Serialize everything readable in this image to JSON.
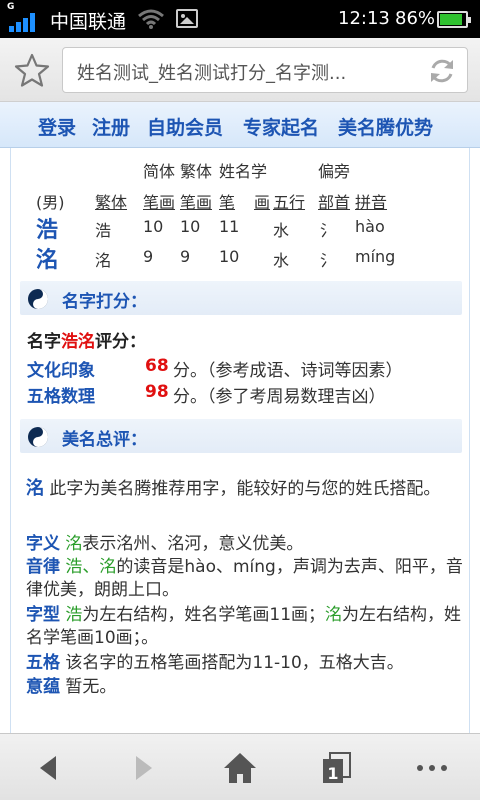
{
  "status_bar": {
    "g_badge": "G",
    "carrier": "中国联通",
    "time": "12:13",
    "battery_pct": "86%",
    "battery_level": 0.86,
    "signal_icon": "signal-bars-icon",
    "wifi_icon": "wifi-icon",
    "picture_icon": "picture-icon"
  },
  "url_bar": {
    "url_text": "姓名测试_姓名测试打分_名字测...",
    "bookmark_icon": "star-icon",
    "reload_icon": "reload-icon"
  },
  "nav": {
    "items": [
      "登录",
      "注册",
      "自助会员",
      "专家起名",
      "美名腾优势"
    ]
  },
  "name_table": {
    "header_row1": [
      "简体",
      "繁体",
      "姓名学",
      "偏旁"
    ],
    "header_row2": [
      "(男)",
      "繁体",
      "笔画",
      "笔画",
      "笔",
      "画",
      "五行",
      "部首",
      "拼音"
    ],
    "rows": [
      {
        "char": "浩",
        "trad": "浩",
        "s1": "10",
        "s2": "10",
        "s3": "11",
        "wuxing": "水",
        "radical": "氵",
        "pinyin": "hào"
      },
      {
        "char": "洺",
        "trad": "洺",
        "s1": "9",
        "s2": "9",
        "s3": "10",
        "wuxing": "水",
        "radical": "氵",
        "pinyin": "míng"
      }
    ]
  },
  "score_section": {
    "title": "名字打分：",
    "label_pre": "名字",
    "label_name": "浩洺",
    "label_post": "评分：",
    "items": [
      {
        "label": "文化印象",
        "score": "68",
        "text": "分。（参考成语、诗词等因素）"
      },
      {
        "label": "五格数理",
        "score": "98",
        "text": "分。（参了考周易数理吉凶）"
      }
    ]
  },
  "review_section": {
    "title": "美名总评：",
    "intro_char": "洺",
    "intro_text": "此字为美名腾推荐用字，能较好的与您的姓氏搭配。",
    "meaning_label": "字义",
    "meaning_char": "洺",
    "meaning_text": "表示洺州、洺河，意义优美。",
    "rhythm_label": "音律",
    "rhythm_char1": "浩",
    "rhythm_sep": "、",
    "rhythm_char2": "洺",
    "rhythm_text": "的读音是hào、míng，声调为去声、阳平，音律优美，朗朗上口。",
    "shape_label": "字型",
    "shape_char1": "浩",
    "shape_text1": "为左右结构，姓名学笔画11画；",
    "shape_char2": "洺",
    "shape_text2": "为左右结构，姓名学笔画10画；。",
    "wuge_label": "五格",
    "wuge_text": "该名字的五格笔画搭配为11-10，五格大吉。",
    "yiyun_label": "意蕴",
    "yiyun_text": "暂无。"
  },
  "toolbar": {
    "icons": [
      "back-arrow-icon",
      "forward-arrow-icon",
      "home-icon",
      "tabs-icon",
      "menu-dots-icon"
    ],
    "tab_count": "1"
  }
}
